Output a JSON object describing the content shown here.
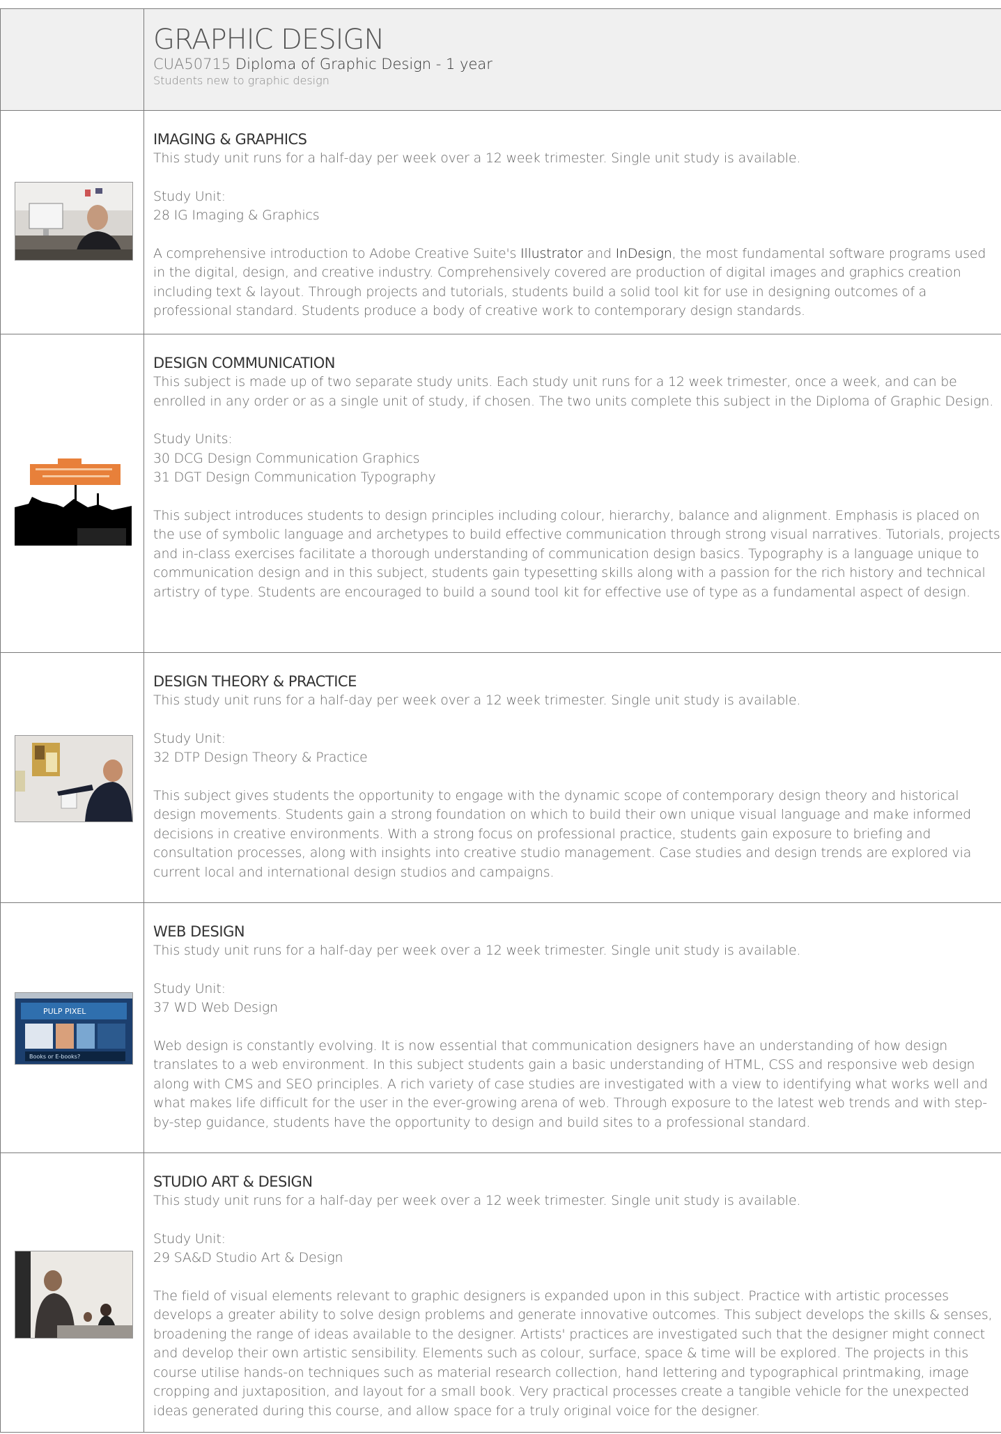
{
  "header": {
    "title": "GRAPHIC DESIGN",
    "code": "CUA50715",
    "diploma": "Diploma of Graphic Design",
    "duration": " -  1 year",
    "note": "Students new to graphic design"
  },
  "sections": [
    {
      "title": "IMAGING & GRAPHICS",
      "intro": "This study unit runs for a half-day per week over a 12 week trimester. Single unit study is available.",
      "units_label": "Study Unit:",
      "units": [
        "28 IG Imaging & Graphics"
      ],
      "desc_pre": "A comprehensive introduction to Adobe Creative Suite's ",
      "desc_hl1": "Illustrator",
      "desc_mid": " and ",
      "desc_hl2": "InDesign",
      "desc_post": ", the most fundamental software programs used in the digital, design, and creative industry. Comprehensively covered are production of digital images and graphics creation including text & layout.  Through projects and tutorials, students build a solid tool kit for use in designing outcomes of a professional standard. Students produce a body of creative work to contemporary design standards.",
      "image": "photo-instructor-at-computer"
    },
    {
      "title": "DESIGN COMMUNICATION",
      "intro": "This subject is made up of two separate study units. Each study unit runs for a 12 week trimester, once a week, and can be enrolled in any order or as a single unit of study, if chosen. The two units complete this subject in the Diploma of Graphic Design.",
      "units_label": "Study Units:",
      "units": [
        "30 DCG Design Communication Graphics",
        "31 DGT Design Communication Typography"
      ],
      "desc": "This subject introduces students to design principles including colour, hierarchy, balance and alignment. Emphasis is placed on the use of symbolic language and archetypes to build effective communication through strong visual narratives. Tutorials, projects and in-class exercises facilitate a thorough understanding of communication design basics. Typography is a language unique to communication design and in this subject, students gain typesetting skills along with a passion for the rich history and technical artistry of type. Students are encouraged to build a sound tool kit for effective use of type as a fundamental aspect of design.",
      "image": "graphic-billboard-silhouette"
    },
    {
      "title": "DESIGN THEORY & PRACTICE",
      "intro": "This study unit runs for a half-day per week over a 12 week trimester. Single unit study is available.",
      "units_label": "Study Unit:",
      "units": [
        "32 DTP Design Theory & Practice"
      ],
      "desc": "This subject gives students the opportunity to engage with the dynamic scope of contemporary design theory and historical design movements. Students gain a strong foundation on which to build their own unique visual language and make informed decisions in creative environments.  With a strong focus on professional practice, students gain exposure to briefing and consultation processes, along with insights into creative studio management. Case studies and design trends are explored via current local and international design studios and campaigns.",
      "image": "photo-presenter-at-wall"
    },
    {
      "title": "WEB DESIGN",
      "intro": "This study unit runs for a half-day per week over a 12 week trimester. Single unit study is available.",
      "units_label": "Study Unit:",
      "units": [
        "37 WD Web Design"
      ],
      "desc": "Web design is constantly evolving. It is now essential that communication designers have an understanding of how design translates to a web environment. In this subject students gain a basic understanding of HTML, CSS and responsive web design along with CMS and SEO principles.  A rich variety of case studies are investigated with a view to identifying what works well and what makes life difficult for the user in the ever-growing arena of web. Through exposure to the latest web trends and with step-by-step guidance, students have the opportunity to design and build sites to a professional standard.",
      "image": "screenshot-website"
    },
    {
      "title": "STUDIO ART & DESIGN",
      "intro": "This study unit runs for a half-day per week over a 12 week trimester. Single unit study is available.",
      "units_label": "Study Unit:",
      "units": [
        "29 SA&D Studio Art & Design"
      ],
      "desc": "The field of visual elements relevant to graphic designers is expanded upon in this subject. Practice with artistic processes develops a greater ability to solve design problems and generate innovative outcomes. This subject develops the skills & senses, broadening the range of ideas available to the designer. Artists' practices are investigated such that the designer might connect and develop their own artistic sensibility. Elements such as colour, surface, space & time will be explored. The projects in this course utilise hands-on techniques such as material research collection, hand lettering and typographical printmaking, image cropping and juxtaposition, and layout for a small book. Very practical processes create a tangible vehicle for the unexpected ideas generated during this course, and allow space for a truly original voice for the designer.",
      "image": "photo-classroom-students"
    }
  ]
}
